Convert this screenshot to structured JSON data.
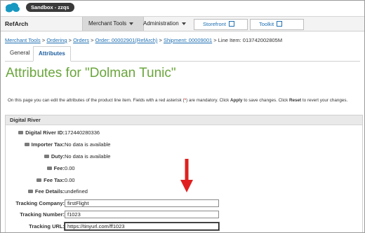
{
  "topbar": {
    "sandbox_label": "Sandbox - zzqs"
  },
  "nav": {
    "brand": "RefArch",
    "merchant_tools": "Merchant Tools",
    "administration": "Administration",
    "storefront": "Storefront",
    "toolkit": "Toolkit"
  },
  "breadcrumb": {
    "items": [
      "Merchant Tools",
      "Ordering",
      "Orders",
      "Order: 00002901(RefArch)",
      "Shipment: 00009001"
    ],
    "current": "Line Item: 013742002805M",
    "separator": ">"
  },
  "tabs": {
    "general": "General",
    "attributes": "Attributes"
  },
  "page": {
    "title": "Attributes for \"Dolman Tunic\"",
    "desc_prefix": "On this page you can edit the attributes of the product line item. Fields with a red asterisk (",
    "desc_asterisk": "*",
    "desc_mid1": ") are mandatory. Click ",
    "desc_apply": "Apply",
    "desc_mid2": " to save changes. Click ",
    "desc_reset": "Reset",
    "desc_suffix": " to revert your changes."
  },
  "section": {
    "title": "Digital River",
    "rows": [
      {
        "label": "Digital River ID:",
        "value": "172440280336"
      },
      {
        "label": "Importer Tax:",
        "value": "No data is available"
      },
      {
        "label": "Duty:",
        "value": "No data is available"
      },
      {
        "label": "Fee:",
        "value": "0.00"
      },
      {
        "label": "Fee Tax:",
        "value": "0.00"
      },
      {
        "label": "Fee Details:",
        "value": "undefined"
      }
    ],
    "inputs": [
      {
        "label": "Tracking Company:",
        "value": "firstFlight"
      },
      {
        "label": "Tracking Number:",
        "value": "f1023"
      },
      {
        "label": "Tracking URL:",
        "value": "https://tinyurl.com/ff1023"
      }
    ]
  },
  "colors": {
    "title_green": "#6aa63c",
    "link_blue": "#1f6fb2",
    "arrow_red": "#e02020"
  }
}
